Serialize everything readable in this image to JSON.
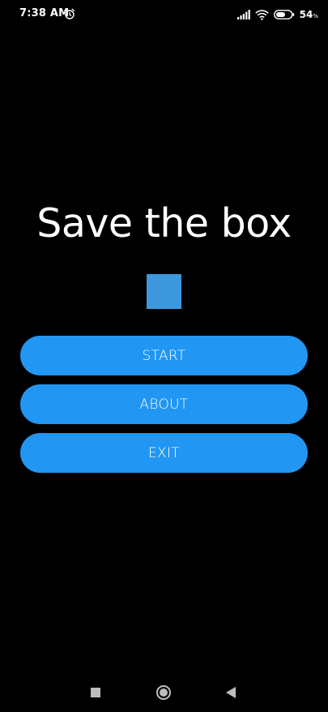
{
  "status_bar": {
    "time": "7:38 AM",
    "battery_percent": "54",
    "battery_unit": "%",
    "icons": [
      "alarm-icon",
      "signal-icon",
      "wifi-icon",
      "battery-icon"
    ]
  },
  "main": {
    "title": "Save the box",
    "box_color": "#3d97dc",
    "buttons": [
      {
        "label": "START"
      },
      {
        "label": "ABOUT"
      },
      {
        "label": "EXIT"
      }
    ],
    "button_color": "#2196f3"
  },
  "nav_bar": {
    "icons": [
      "recent-apps-icon",
      "home-icon",
      "back-icon"
    ]
  }
}
